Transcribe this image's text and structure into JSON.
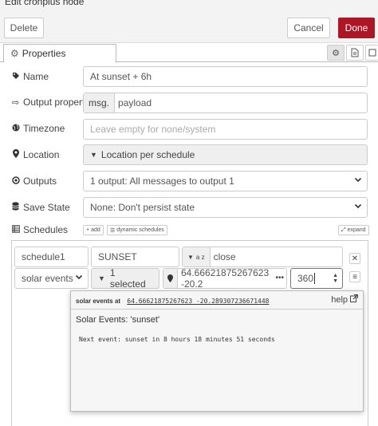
{
  "window": {
    "title": "Edit cronplus node"
  },
  "toolbar": {
    "delete_label": "Delete",
    "cancel_label": "Cancel",
    "done_label": "Done"
  },
  "tabs": {
    "properties_label": "Properties"
  },
  "form": {
    "name": {
      "label": "Name",
      "value": "At sunset + 6h"
    },
    "output_property": {
      "label": "Output property",
      "prefix": "msg.",
      "value": "payload"
    },
    "timezone": {
      "label": "Timezone",
      "placeholder": "Leave empty for none/system"
    },
    "location": {
      "label": "Location",
      "value": "Location per schedule"
    },
    "outputs": {
      "label": "Outputs",
      "value": "1 output: All messages to output 1"
    },
    "save_state": {
      "label": "Save State",
      "value": "None: Don't persist state"
    },
    "schedules": {
      "label": "Schedules",
      "add_label": "add",
      "dynamic_label": "dynamic schedules",
      "expand_label": "expand"
    }
  },
  "schedule_row": {
    "name": "schedule1",
    "topic": "SUNSET",
    "payload_type_glyph": "a z",
    "payload": "close",
    "kind": "solar events",
    "events": "1 selected",
    "location": "64.66621875267623 -20.2",
    "offset": "360"
  },
  "popup": {
    "header_prefix": "solar events at",
    "header_coords": "64.66621875267623 -20.289307236671448",
    "help_label": "help",
    "events_text": "Solar Events: 'sunset'",
    "next_event_text": "Next event: sunset in 8 hours 18 minutes 51 seconds"
  },
  "colors": {
    "accent": "#ad1625",
    "border": "#cccccc",
    "toolbar_bg": "#f3f3f3"
  },
  "icons": [
    "cog-icon",
    "tag-icon",
    "sign-out-icon",
    "globe-icon",
    "map-marker-icon",
    "dot-circle-icon",
    "database-icon",
    "list-icon",
    "caret-down-icon",
    "plus-icon",
    "list-alt-icon",
    "expand-icon",
    "close-icon",
    "bars-icon",
    "ellipsis-icon",
    "external-link-icon",
    "file-icon",
    "book-icon"
  ]
}
